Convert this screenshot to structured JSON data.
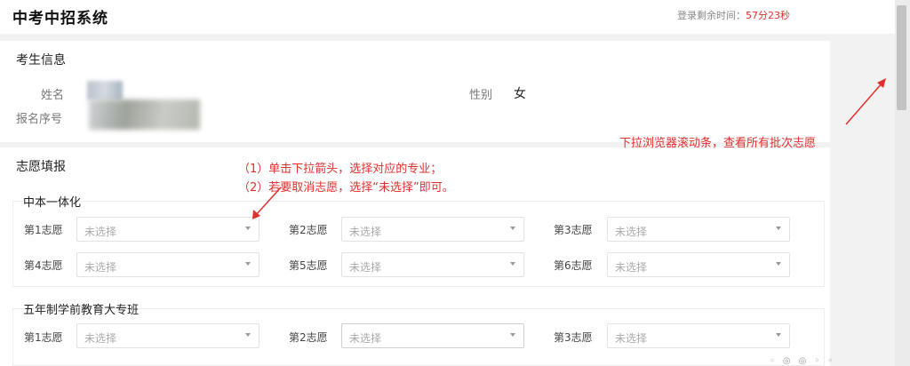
{
  "header": {
    "title": "中考中招系统",
    "timer_label": "登录剩余时间：",
    "timer_value": "57分23秒"
  },
  "student": {
    "section_title": "考生信息",
    "name_label": "姓名",
    "gender_label": "性别",
    "gender_value": "女",
    "seq_label": "报名序号"
  },
  "wishes": {
    "section_title": "志愿填报",
    "groups": [
      {
        "name": "中本一体化",
        "items": [
          {
            "label": "第1志愿",
            "value": "未选择"
          },
          {
            "label": "第2志愿",
            "value": "未选择"
          },
          {
            "label": "第3志愿",
            "value": "未选择"
          },
          {
            "label": "第4志愿",
            "value": "未选择"
          },
          {
            "label": "第5志愿",
            "value": "未选择"
          },
          {
            "label": "第6志愿",
            "value": "未选择"
          }
        ]
      },
      {
        "name": "五年制学前教育大专班",
        "items": [
          {
            "label": "第1志愿",
            "value": "未选择"
          },
          {
            "label": "第2志愿",
            "value": "未选择"
          },
          {
            "label": "第3志愿",
            "value": "未选择"
          }
        ]
      }
    ]
  },
  "annotations": {
    "instruction_1": "（1）单击下拉箭头，选择对应的专业；",
    "instruction_2": "（2）若要取消志愿，选择“未选择”即可。",
    "scroll_hint": "下拉浏览器滚动条，查看所有批次志愿",
    "color": "#e0302e"
  }
}
